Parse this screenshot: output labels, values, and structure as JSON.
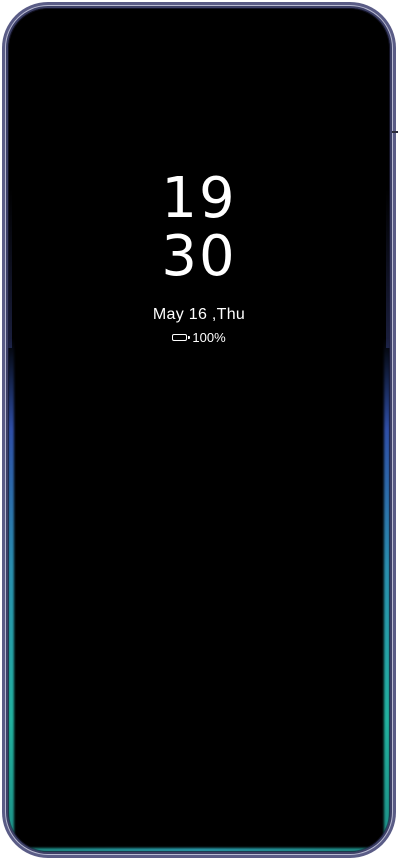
{
  "clock": {
    "hours": "19",
    "minutes": "30"
  },
  "date_label": "May 16 ,Thu",
  "battery": {
    "icon": "battery-icon",
    "level_label": "100%",
    "level_fraction": 1.0
  },
  "colors": {
    "background": "#000000",
    "text": "#ffffff",
    "edge_glow_primary": "#22b3a0",
    "edge_glow_secondary": "#2f4fa8",
    "frame": "#5a5c86"
  }
}
